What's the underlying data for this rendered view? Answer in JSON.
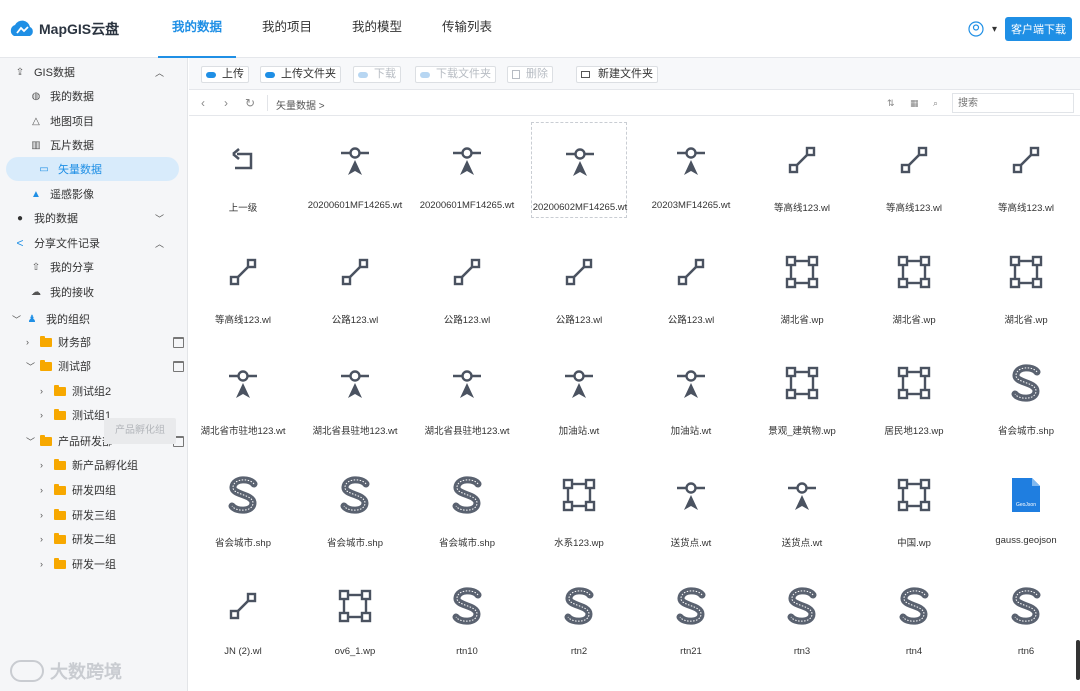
{
  "app": {
    "logo_text": "MapGIS云盘"
  },
  "nav": {
    "tabs": [
      {
        "label": "我的数据",
        "active": true
      },
      {
        "label": "我的项目",
        "active": false
      },
      {
        "label": "我的模型",
        "active": false
      },
      {
        "label": "传输列表",
        "active": false
      }
    ],
    "download_client": "客户端下载"
  },
  "sidebar": {
    "gis_data": "GIS数据",
    "my_data_1": "我的数据",
    "map_project": "地图项目",
    "tile_data": "瓦片数据",
    "vector_data": "矢量数据",
    "remote_image": "遥感影像",
    "my_data_2": "我的数据",
    "share_records": "分享文件记录",
    "my_share": "我的分享",
    "my_receive": "我的接收",
    "my_org": "我的组织",
    "finance": "财务部",
    "test_dept": "测试部",
    "test_group2": "测试组2",
    "test_group1": "测试组1",
    "product_dept": "产品研发部",
    "new_product": "新产品孵化组",
    "rd4": "研发四组",
    "rd3": "研发三组",
    "rd2": "研发二组",
    "rd1": "研发一组",
    "tooltip": "产品孵化组",
    "watermark": "大数跨境"
  },
  "toolbar": {
    "upload": "上传",
    "upload_folder": "上传文件夹",
    "download": "下载",
    "download_folder": "下载文件夹",
    "delete": "删除",
    "new_folder": "新建文件夹"
  },
  "breadcrumb": {
    "path": "矢量数据  >"
  },
  "search": {
    "placeholder": "搜索"
  },
  "files": [
    {
      "name": "上一级",
      "icon": "back-icon"
    },
    {
      "name": "20200601MF14265.wt",
      "icon": "point-icon"
    },
    {
      "name": "20200601MF14265.wt",
      "icon": "point-icon"
    },
    {
      "name": "20200602MF14265.wt",
      "icon": "point-icon",
      "selected": true
    },
    {
      "name": "20203MF14265.wt",
      "icon": "point-icon"
    },
    {
      "name": "等高线123.wl",
      "icon": "line-icon"
    },
    {
      "name": "等高线123.wl",
      "icon": "line-icon"
    },
    {
      "name": "等高线123.wl",
      "icon": "line-icon"
    },
    {
      "name": "等高线123.wl",
      "icon": "line-icon"
    },
    {
      "name": "公路123.wl",
      "icon": "line-icon"
    },
    {
      "name": "公路123.wl",
      "icon": "line-icon"
    },
    {
      "name": "公路123.wl",
      "icon": "line-icon"
    },
    {
      "name": "公路123.wl",
      "icon": "line-icon"
    },
    {
      "name": "湖北省.wp",
      "icon": "polygon-icon"
    },
    {
      "name": "湖北省.wp",
      "icon": "polygon-icon"
    },
    {
      "name": "湖北省.wp",
      "icon": "polygon-icon"
    },
    {
      "name": "湖北省市驻地123.wt",
      "icon": "point-icon"
    },
    {
      "name": "湖北省县驻地123.wt",
      "icon": "point-icon"
    },
    {
      "name": "湖北省县驻地123.wt",
      "icon": "point-icon"
    },
    {
      "name": "加油站.wt",
      "icon": "point-icon"
    },
    {
      "name": "加油站.wt",
      "icon": "point-icon"
    },
    {
      "name": "景观_建筑物.wp",
      "icon": "polygon-icon"
    },
    {
      "name": "居民地123.wp",
      "icon": "polygon-icon"
    },
    {
      "name": "省会城市.shp",
      "icon": "shp-icon"
    },
    {
      "name": "省会城市.shp",
      "icon": "shp-icon"
    },
    {
      "name": "省会城市.shp",
      "icon": "shp-icon"
    },
    {
      "name": "省会城市.shp",
      "icon": "shp-icon"
    },
    {
      "name": "水系123.wp",
      "icon": "polygon-icon"
    },
    {
      "name": "送货点.wt",
      "icon": "point-icon"
    },
    {
      "name": "送货点.wt",
      "icon": "point-icon"
    },
    {
      "name": "中国.wp",
      "icon": "polygon-icon"
    },
    {
      "name": "gauss.geojson",
      "icon": "geojson-icon"
    },
    {
      "name": "JN (2).wl",
      "icon": "line-icon"
    },
    {
      "name": "ov6_1.wp",
      "icon": "polygon-icon"
    },
    {
      "name": "rtn10",
      "icon": "rtn-icon"
    },
    {
      "name": "rtn2",
      "icon": "rtn-icon"
    },
    {
      "name": "rtn21",
      "icon": "rtn-icon"
    },
    {
      "name": "rtn3",
      "icon": "rtn-icon"
    },
    {
      "name": "rtn4",
      "icon": "rtn-icon"
    },
    {
      "name": "rtn6",
      "icon": "rtn-icon"
    }
  ],
  "colors": {
    "accent": "#1f8fe5",
    "icon": "#4a5260",
    "folder": "#f7a800",
    "selected_bg": "#d8ebfb"
  }
}
